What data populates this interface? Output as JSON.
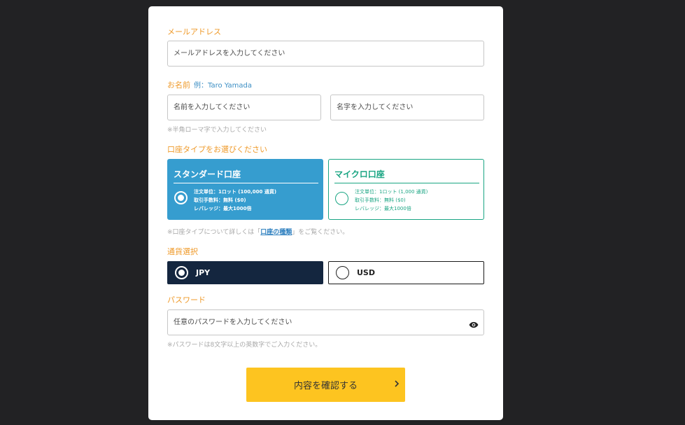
{
  "email": {
    "label": "メールアドレス",
    "placeholder": "メールアドレスを入力してください"
  },
  "name": {
    "label": "お名前",
    "example": "例：Taro Yamada",
    "first_placeholder": "名前を入力してください",
    "last_placeholder": "名字を入力してください",
    "note": "※半角ローマ字で入力してください"
  },
  "account_type": {
    "label": "口座タイプをお選びください",
    "standard": {
      "title": "スタンダード口座",
      "selected": true,
      "lines": [
        "注文単位：1ロット (100,000 通貨)",
        "取引手数料：無料 ($0)",
        "レバレッジ：最大1000倍"
      ]
    },
    "micro": {
      "title": "マイクロ口座",
      "selected": false,
      "lines": [
        "注文単位：1ロット (1,000 通貨)",
        "取引手数料：無料 ($0)",
        "レバレッジ：最大1000倍"
      ]
    },
    "note_prefix": "※口座タイプについて詳しくは「",
    "note_link": "口座の種類",
    "note_suffix": "」をご覧ください。"
  },
  "currency": {
    "label": "通貨選択",
    "jpy": {
      "label": "JPY",
      "selected": true
    },
    "usd": {
      "label": "USD",
      "selected": false
    }
  },
  "password": {
    "label": "パスワード",
    "placeholder": "任意のパスワードを入力してください",
    "toggle_icon": "eye-icon",
    "note": "※パスワードは8文字以上の英数字でご入力ください。"
  },
  "submit": {
    "label": "内容を確認する",
    "icon": "chevron-right-icon"
  },
  "colors": {
    "accent_label": "#ef9a2a",
    "standard_blue": "#369dcf",
    "micro_green": "#1aa583",
    "jpy_navy": "#14263f",
    "submit_yellow": "#fdc420"
  }
}
